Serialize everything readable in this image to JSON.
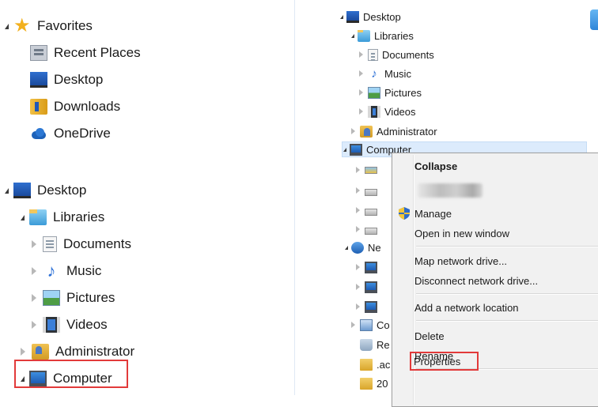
{
  "left_pane": {
    "favorites": {
      "label": "Favorites",
      "icon": "star-icon",
      "items": [
        {
          "label": "Recent Places",
          "icon": "recent-places-icon"
        },
        {
          "label": "Desktop",
          "icon": "desktop-icon"
        },
        {
          "label": "Downloads",
          "icon": "downloads-folder-icon"
        },
        {
          "label": "OneDrive",
          "icon": "onedrive-cloud-icon"
        }
      ]
    },
    "desktop": {
      "label": "Desktop",
      "libraries": {
        "label": "Libraries",
        "items": [
          {
            "label": "Documents",
            "icon": "documents-icon"
          },
          {
            "label": "Music",
            "icon": "music-icon"
          },
          {
            "label": "Pictures",
            "icon": "pictures-icon"
          },
          {
            "label": "Videos",
            "icon": "videos-icon"
          }
        ]
      },
      "administrator": "Administrator",
      "computer": "Computer"
    }
  },
  "right_pane": {
    "desktop": "Desktop",
    "libraries": "Libraries",
    "library_items": [
      "Documents",
      "Music",
      "Pictures",
      "Videos"
    ],
    "administrator": "Administrator",
    "computer": "Computer",
    "partial_labels": {
      "network": "Ne",
      "control_panel": "Co",
      "recycle_bin": "Re",
      "folder_ac": ".ac",
      "folder_20": "20"
    }
  },
  "context_menu": {
    "items": [
      {
        "label": "Collapse",
        "bold": true
      },
      {
        "label": "Manage",
        "icon": "uac-shield-icon"
      },
      {
        "label": "Open in new window"
      },
      {
        "label": "Map network drive..."
      },
      {
        "label": "Disconnect network drive..."
      },
      {
        "label": "Add a network location"
      },
      {
        "label": "Delete"
      },
      {
        "label": "Rename"
      },
      {
        "label": "Properties"
      }
    ]
  },
  "highlight_color": "#e23a3a",
  "selection_color": "#dcebfc"
}
